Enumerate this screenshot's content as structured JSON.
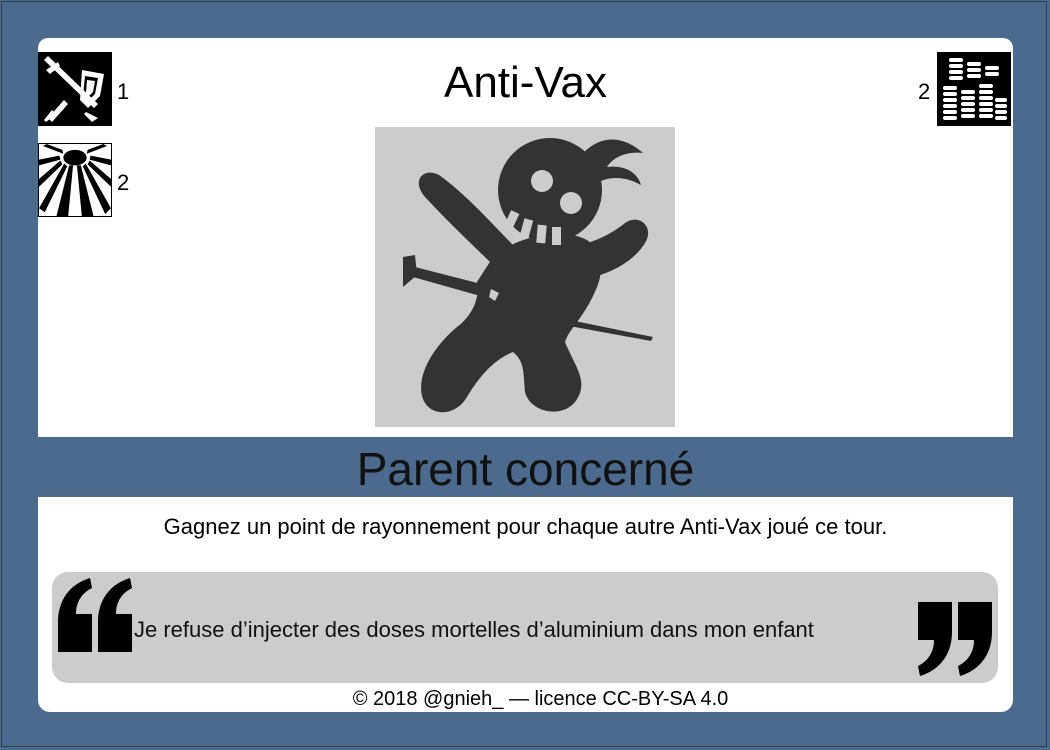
{
  "card": {
    "title": "Anti-Vax",
    "subtitle": "Parent concerné",
    "effect": "Gagnez un point de rayonnement pour chaque autre Anti-Vax joué ce tour.",
    "quote": "Je refuse d’injecter des doses mortelles d’aluminium dans mon enfant",
    "footer": "© 2018 @gnieh_ — licence CC-BY-SA 4.0"
  },
  "stats": {
    "attack": {
      "icon": "sword-shield-icon",
      "value": "1"
    },
    "influence": {
      "icon": "sun-rays-icon",
      "value": "2"
    },
    "cost": {
      "icon": "coin-stacks-icon",
      "value": "2"
    }
  },
  "illustration": {
    "icon": "voodoo-doll-icon"
  },
  "colors": {
    "background": "#4b6a8e",
    "card": "#ffffff",
    "panel_gray": "#cccccc",
    "icon_dark": "#333333"
  }
}
